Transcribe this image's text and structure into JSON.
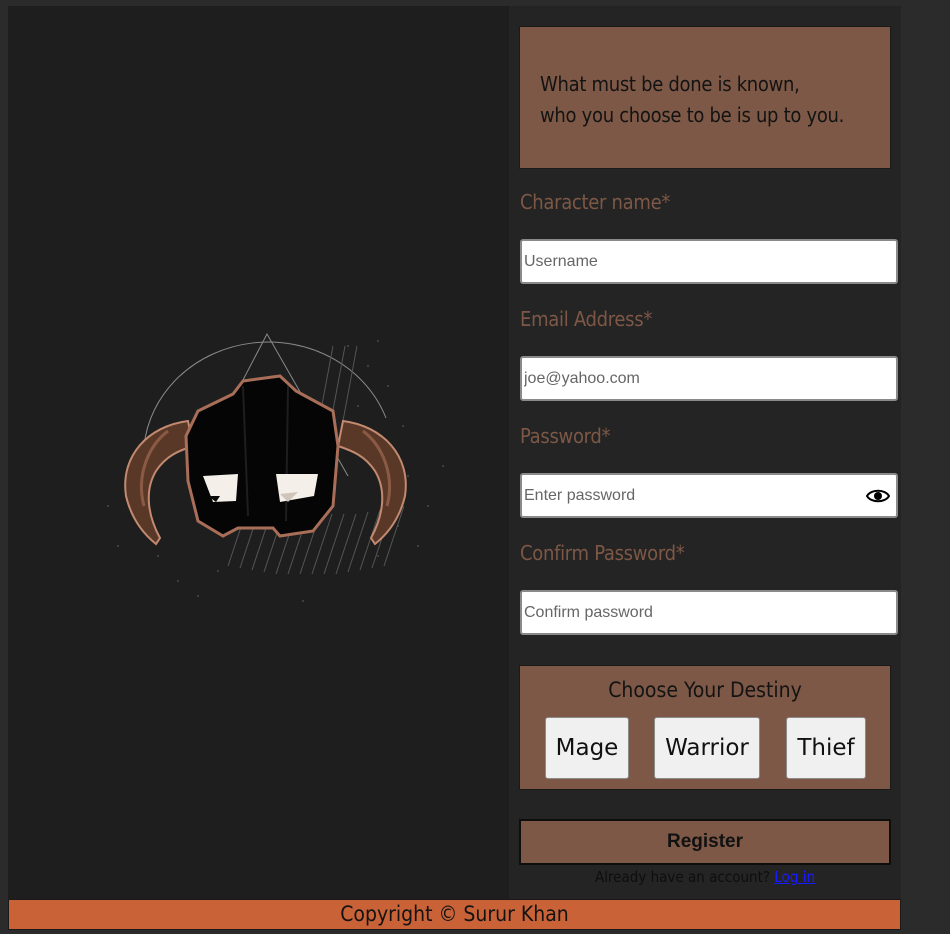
{
  "quote": {
    "line1": "What must be done is known,",
    "line2": "who you choose to be is up to you."
  },
  "form": {
    "character_name": {
      "label": "Character name",
      "required_mark": "*",
      "placeholder": "Username",
      "value": ""
    },
    "email": {
      "label": "Email Address",
      "required_mark": "*",
      "placeholder": "joe@yahoo.com",
      "value": ""
    },
    "password": {
      "label": "Password",
      "required_mark": "*",
      "placeholder": "Enter password",
      "value": "",
      "icon": "eye-icon"
    },
    "confirm_password": {
      "label": "Confirm Password",
      "required_mark": "*",
      "placeholder": "Confirm password",
      "value": ""
    }
  },
  "destiny": {
    "title": "Choose Your Destiny",
    "classes": [
      "Mage",
      "Warrior",
      "Thief"
    ]
  },
  "register_label": "Register",
  "account": {
    "prompt": "Already have an account?",
    "login_link": "Log in"
  },
  "footer": {
    "copyright": "Copyright © Surur Khan"
  },
  "colors": {
    "accent_brown": "#7d5846",
    "footer_orange": "#c96337",
    "panel_bg": "#242424",
    "hero_bg": "#1e1e1e"
  }
}
